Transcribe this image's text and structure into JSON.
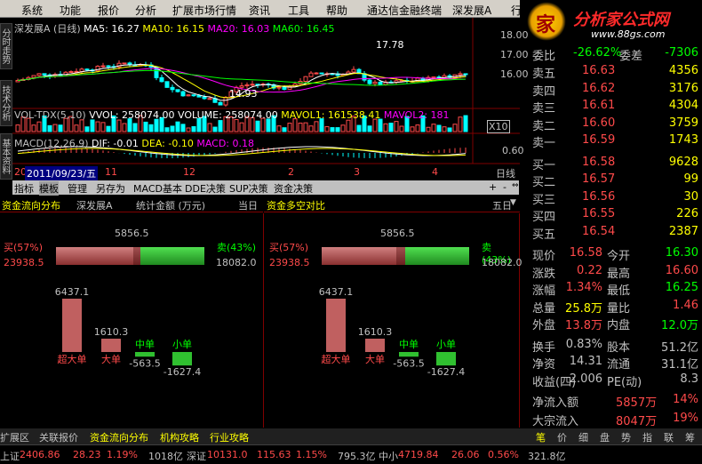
{
  "menu": [
    "系统",
    "功能",
    "报价",
    "分析",
    "扩展市场行情",
    "资讯",
    "工具",
    "帮助",
    "通达信金融终端",
    "深发展A",
    "行"
  ],
  "logo": {
    "title": "分析家公式网",
    "url": "www.88gs.com",
    "mark": "家"
  },
  "side_tabs": [
    "分时走势",
    "技术分析",
    "基本资料"
  ],
  "kline": {
    "info": [
      "深发展A (日线)",
      "MA5: 16.27",
      "MA10: 16.15",
      "MA20: 16.03",
      "MA60: 16.45"
    ],
    "info_colors": [
      "#c0c0c0",
      "#ffffff",
      "#ffff00",
      "#ff00ff",
      "#00ff00"
    ],
    "high_label": "17.78",
    "low_label": "14.93",
    "yticks": [
      "18.00",
      "17.00",
      "16.00"
    ]
  },
  "vol": {
    "info": [
      "VOL-TDX(5,10)",
      "VVOL: 258074.00",
      "VOLUME: 258074.00",
      "MAVOL1: 161538.41",
      "MAVOL2: 181"
    ],
    "info_colors": [
      "#c0c0c0",
      "#ffffff",
      "#ffffff",
      "#ffff00",
      "#ff00ff"
    ],
    "ytick": "X10"
  },
  "macd": {
    "info": [
      "MACD(12,26,9)",
      "DIF: -0.01",
      "DEA: -0.10",
      "MACD: 0.18"
    ],
    "info_colors": [
      "#c0c0c0",
      "#ffffff",
      "#ffff00",
      "#ff00ff"
    ],
    "ytick": "0.60"
  },
  "timeline": {
    "date": "2011/09/23/五",
    "marks": [
      "20",
      "11",
      "12",
      "2",
      "3",
      "4"
    ],
    "period": "日线"
  },
  "tools": [
    "指标",
    "模板",
    "管理",
    "另存为",
    "MACD基本",
    "DDE决策",
    "SUP决策",
    "资金决策"
  ],
  "tools_nav": [
    "+",
    "-",
    "⇔"
  ],
  "panel_left": {
    "title": "资金流向分布",
    "stock": "深发展A",
    "mode": "统计金额 (万元)",
    "period": "当日",
    "buy_label": "买(57%)",
    "buy_value": "23938.5",
    "sell_label": "卖(43%)",
    "sell_value": "18082.0",
    "net": "5856.5",
    "bars": [
      {
        "name": "超大单",
        "value": "6437.1",
        "num": 6437.1
      },
      {
        "name": "大单",
        "value": "1610.3",
        "num": 1610.3
      },
      {
        "name": "中单",
        "value": "-563.5",
        "num": -563.5
      },
      {
        "name": "小单",
        "value": "-1627.4",
        "num": -1627.4
      }
    ]
  },
  "panel_right": {
    "title": "资金多空对比",
    "period": "五日",
    "buy_label": "买(57%)",
    "buy_value": "23938.5",
    "sell_label": "卖(43%)",
    "sell_value": "18082.0",
    "net": "5856.5",
    "bars": [
      {
        "name": "超大单",
        "value": "6437.1",
        "num": 6437.1
      },
      {
        "name": "大单",
        "value": "1610.3",
        "num": 1610.3
      },
      {
        "name": "中单",
        "value": "-563.5",
        "num": -563.5
      },
      {
        "name": "小单",
        "value": "-1627.4",
        "num": -1627.4
      }
    ]
  },
  "quote_header": {
    "row1_label": "委比",
    "row1_value": "-26.62%",
    "row1_label2": "委差",
    "row1_value2": "-7306"
  },
  "sell_orders": [
    {
      "label": "卖五",
      "price": "16.63",
      "vol": "4356"
    },
    {
      "label": "卖四",
      "price": "16.62",
      "vol": "3176"
    },
    {
      "label": "卖三",
      "price": "16.61",
      "vol": "4304"
    },
    {
      "label": "卖二",
      "price": "16.60",
      "vol": "3759"
    },
    {
      "label": "卖一",
      "price": "16.59",
      "vol": "1743"
    }
  ],
  "buy_orders": [
    {
      "label": "买一",
      "price": "16.58",
      "vol": "9628"
    },
    {
      "label": "买二",
      "price": "16.57",
      "vol": "99"
    },
    {
      "label": "买三",
      "price": "16.56",
      "vol": "30"
    },
    {
      "label": "买四",
      "price": "16.55",
      "vol": "226"
    },
    {
      "label": "买五",
      "price": "16.54",
      "vol": "2387"
    }
  ],
  "stats": [
    {
      "l1": "现价",
      "v1": "16.58",
      "c1": "#ff4a4a",
      "l2": "今开",
      "v2": "16.30",
      "c2": "#00ff00"
    },
    {
      "l1": "涨跌",
      "v1": "0.22",
      "c1": "#ff4a4a",
      "l2": "最高",
      "v2": "16.60",
      "c2": "#ff4a4a"
    },
    {
      "l1": "涨幅",
      "v1": "1.34%",
      "c1": "#ff4a4a",
      "l2": "最低",
      "v2": "16.25",
      "c2": "#00ff00"
    },
    {
      "l1": "总量",
      "v1": "25.8万",
      "c1": "#ffff00",
      "l2": "量比",
      "v2": "1.46",
      "c2": "#ff4a4a"
    },
    {
      "l1": "外盘",
      "v1": "13.8万",
      "c1": "#ff4a4a",
      "l2": "内盘",
      "v2": "12.0万",
      "c2": "#00ff00"
    }
  ],
  "stats2": [
    {
      "l1": "换手",
      "v1": "0.83%",
      "l2": "股本",
      "v2": "51.2亿"
    },
    {
      "l1": "净资",
      "v1": "14.31",
      "l2": "流通",
      "v2": "31.1亿"
    },
    {
      "l1": "收益(四)",
      "v1": "2.006",
      "l2": "PE(动)",
      "v2": "8.3"
    }
  ],
  "flows": [
    {
      "label": "净流入额",
      "value": "5857万",
      "pct": "14%"
    },
    {
      "label": "大宗流入",
      "value": "8047万",
      "pct": "19%"
    }
  ],
  "bottom_tabs": [
    "扩展区",
    "关联报价",
    "资金流向分布",
    "机构攻略",
    "行业攻略"
  ],
  "right_tabs": [
    "笔",
    "价",
    "细",
    "盘",
    "势",
    "指",
    "联",
    "筹"
  ],
  "status": {
    "sh_label": "上证",
    "sh_val": "2406.86",
    "sh_chg": "28.23",
    "sh_pct": "1.19%",
    "sh_amt": "1018亿",
    "sz_label": "深证",
    "sz_val": "10131.0",
    "sz_chg": "115.63",
    "sz_pct": "1.15%",
    "sz_amt": "795.3亿",
    "zx_label": "中小",
    "zx_val": "4719.84",
    "zx_chg": "26.06",
    "zx_pct": "0.56%",
    "zx_amt": "321.8亿"
  },
  "colors": {
    "up": "#ff4a4a",
    "down": "#00ff00",
    "accent": "#ffff00",
    "frame": "#800000"
  }
}
